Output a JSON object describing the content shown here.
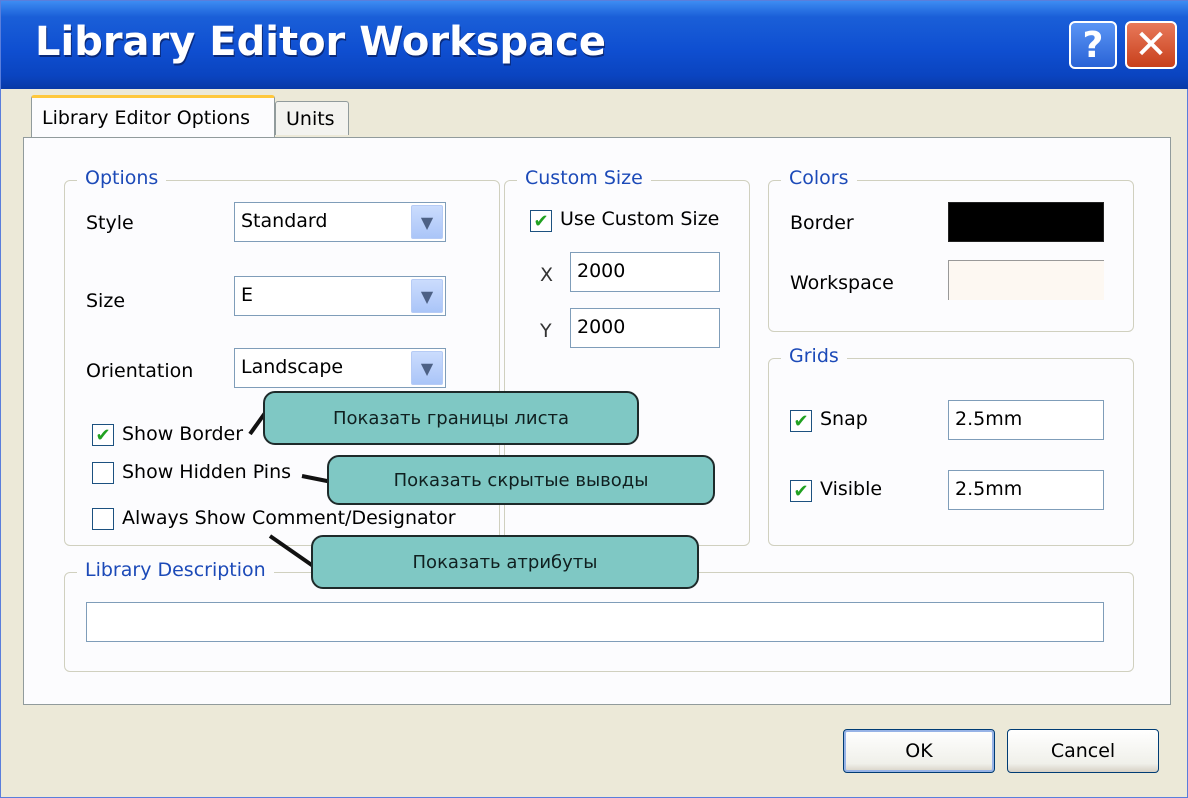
{
  "window": {
    "title": "Library Editor Workspace",
    "help_glyph": "?",
    "close_glyph": "✕"
  },
  "tabs": [
    {
      "label": "Library Editor Options",
      "active": true
    },
    {
      "label": "Units",
      "active": false
    }
  ],
  "options": {
    "title": "Options",
    "style": {
      "label": "Style",
      "value": "Standard"
    },
    "size": {
      "label": "Size",
      "value": "E"
    },
    "orientation": {
      "label": "Orientation",
      "value": "Landscape"
    },
    "show_border": {
      "label": "Show Border",
      "checked": true
    },
    "show_hidden_pins": {
      "label": "Show Hidden Pins",
      "checked": false
    },
    "always_show": {
      "label": "Always Show Comment/Designator",
      "checked": false
    }
  },
  "custom_size": {
    "title": "Custom Size",
    "use_custom": {
      "label": "Use Custom Size",
      "checked": true
    },
    "x": {
      "label": "X",
      "value": "2000"
    },
    "y": {
      "label": "Y",
      "value": "2000"
    }
  },
  "colors": {
    "title": "Colors",
    "border": {
      "label": "Border",
      "color": "#000000"
    },
    "workspace": {
      "label": "Workspace",
      "color": "#fdf8f2"
    }
  },
  "grids": {
    "title": "Grids",
    "snap": {
      "label": "Snap",
      "checked": true,
      "value": "2.5mm"
    },
    "visible": {
      "label": "Visible",
      "checked": true,
      "value": "2.5mm"
    }
  },
  "library_description": {
    "title": "Library Description",
    "value": ""
  },
  "callouts": {
    "border": "Показать границы листа",
    "hidden_pins": "Показать скрытые выводы",
    "attributes": "Показать атрибуты"
  },
  "buttons": {
    "ok": "OK",
    "cancel": "Cancel"
  },
  "check_glyph": "✔",
  "dropdown_glyph": "▼"
}
